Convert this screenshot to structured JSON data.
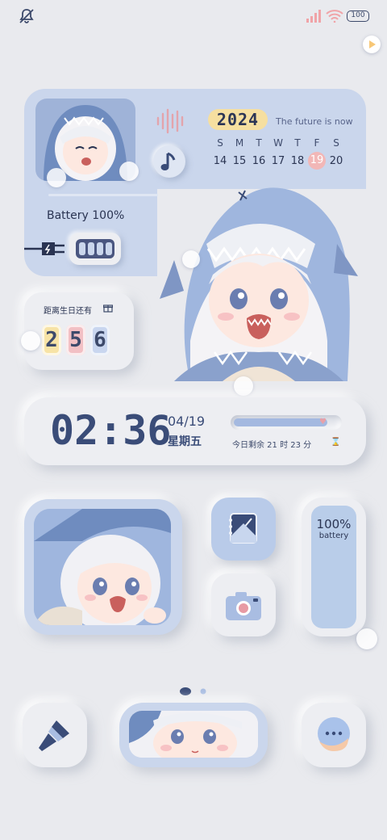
{
  "status_bar": {
    "icons": [
      "mute-icon",
      "signal-icon",
      "wifi-icon"
    ],
    "battery_level": "100"
  },
  "top_widget": {
    "year": "2024",
    "tagline": "The future is now",
    "weekdays": [
      "S",
      "M",
      "T",
      "W",
      "T",
      "F",
      "S"
    ],
    "days": [
      "14",
      "15",
      "16",
      "17",
      "18",
      "19",
      "20"
    ],
    "today": "19",
    "battery_label": "Battery 100%",
    "icons": [
      "sound-wave-icon",
      "music-note-icon",
      "plug-icon"
    ]
  },
  "birthday": {
    "title": "距离生日还有",
    "digits": [
      "2",
      "5",
      "6"
    ],
    "digit_colors": [
      "#f7e3a6",
      "#f2c0c4",
      "#c9d6ef"
    ]
  },
  "clock": {
    "time": "02:36",
    "date": "04/19",
    "weekday": "星期五",
    "remaining": "今日剩余 21 时 23 分",
    "day_progress": 0.89
  },
  "battery_widget": {
    "percent": "100%",
    "label": "battery"
  },
  "dock": {
    "icons": [
      "brush-icon",
      "chat-bubble-icon"
    ]
  },
  "colors": {
    "background": "#e9eaee",
    "accent_blue": "#cad6ec",
    "dark_blue": "#3a4c78",
    "year_pill": "#f6dfa0",
    "today_marker": "#f2b7b7"
  }
}
